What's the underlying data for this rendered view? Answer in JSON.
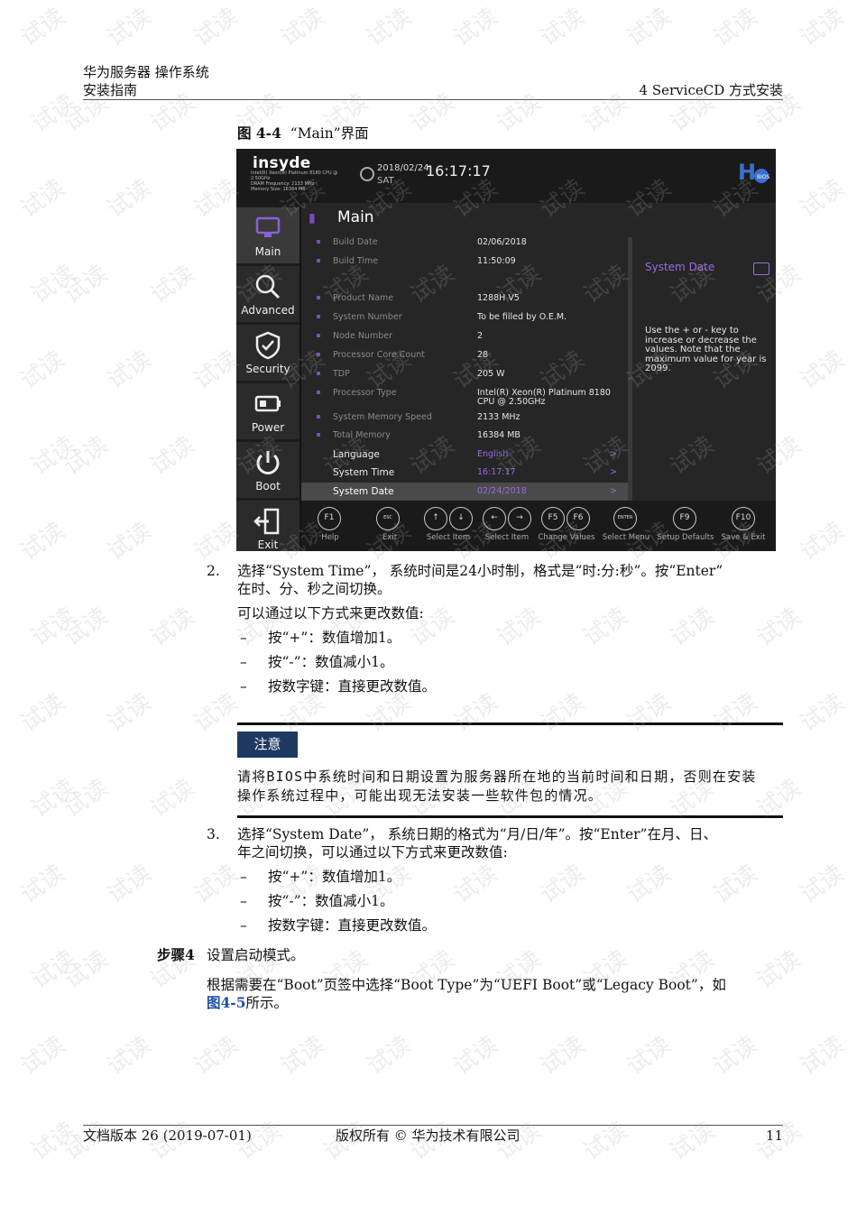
{
  "header": {
    "doc_title": "华为服务器 操作系统",
    "doc_subtitle": "安装指南",
    "chapter": "4 ServiceCD 方式安装"
  },
  "figure": {
    "label": "图 4-4",
    "caption": "“Main”界面"
  },
  "bios": {
    "brand": "insyde",
    "cpu_info": "Intel(R) Xeon(R) Platinum 8180 CPU @\n2.50GHz\nDRAM Frequency: 2133 MHz\nMemory Size: 16384 MB",
    "date": "2018/02/24",
    "day": "SAT",
    "time": "16:17:17",
    "screen_title": "Main",
    "nav": [
      "Main",
      "Advanced",
      "Security",
      "Power",
      "Boot",
      "Exit"
    ],
    "rows": [
      {
        "label": "Build Date",
        "value": "02/06/2018"
      },
      {
        "label": "Build Time",
        "value": "11:50:09"
      },
      {
        "label": "Product Name",
        "value": "1288H V5"
      },
      {
        "label": "System Number",
        "value": "To be filled by O.E.M."
      },
      {
        "label": "Node Number",
        "value": "2"
      },
      {
        "label": "Processor Core Count",
        "value": "28"
      },
      {
        "label": "TDP",
        "value": "205 W"
      },
      {
        "label": "Processor Type",
        "value": "Intel(R) Xeon(R) Platinum 8180",
        "value2": "CPU @ 2.50GHz"
      },
      {
        "label": "System Memory Speed",
        "value": "2133 MHz"
      },
      {
        "label": "Total Memory",
        "value": "16384 MB"
      }
    ],
    "editable_rows": [
      {
        "label": "Language",
        "value": "English",
        "arrow": ">"
      },
      {
        "label": "System Time",
        "value": "16:17:17",
        "arrow": ">"
      },
      {
        "label": "System Date",
        "value": "02/24/2018",
        "arrow": ">"
      }
    ],
    "help_title": "System Date",
    "help_text": "Use the + or - key to increase or decrease the values. Note that the maximum value for year is 2099.",
    "fkeys": [
      {
        "key": "F1",
        "label": "Help"
      },
      {
        "key": "ESC",
        "label": "Exit"
      },
      {
        "key": "↑↓",
        "label": "Select Item"
      },
      {
        "key": "←→",
        "label": "Select Item"
      },
      {
        "key": "F5 F6",
        "label": "Change Values"
      },
      {
        "key": "ENTER",
        "label": "Select Menu"
      },
      {
        "key": "F9",
        "label": "Setup Defaults"
      },
      {
        "key": "F10",
        "label": "Save & Exit"
      }
    ]
  },
  "step2": {
    "num": "2.",
    "line1": "选择“System Time”， 系统时间是24小时制，格式是“时:分:秒”。按“Enter”",
    "line2": "在时、分、秒之间切换。",
    "intro": "可以通过以下方式来更改数值:",
    "items": [
      "按“+”：数值增加1。",
      "按“-”：数值减小1。",
      "按数字键：直接更改数值。"
    ]
  },
  "notice": {
    "badge": "注意",
    "line1": "请将BIOS中系统时间和日期设置为服务器所在地的当前时间和日期，否则在安装",
    "line2": "操作系统过程中，可能出现无法安装一些软件包的情况。"
  },
  "step3": {
    "num": "3.",
    "line1": "选择“System Date”， 系统日期的格式为“月/日/年”。按“Enter”在月、日、",
    "line2": "年之间切换，可以通过以下方式来更改数值:",
    "items": [
      "按“+”：数值增加1。",
      "按“-”：数值减小1。",
      "按数字键：直接更改数值。"
    ]
  },
  "step4": {
    "label": "步骤4",
    "title": "设置启动模式。",
    "line1": "根据需要在“Boot”页签中选择“Boot Type”为“UEFI Boot”或“Legacy Boot”，如",
    "link": "图4-5",
    "line2_rest": "所示。"
  },
  "footer": {
    "version": "文档版本 26 (2019-07-01)",
    "copyright": "版权所有 © 华为技术有限公司",
    "page": "11"
  },
  "watermark": "试读",
  "colors": {
    "accent_purple": "#9a6be0",
    "notice_blue": "#1e3a63",
    "link_blue": "#1f4fa8"
  }
}
